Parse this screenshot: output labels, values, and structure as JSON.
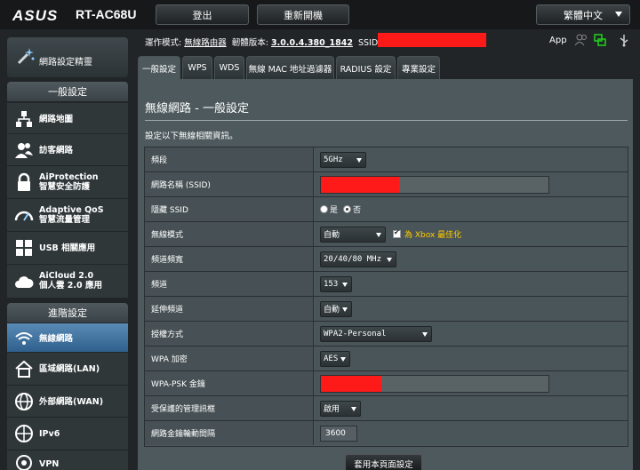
{
  "header": {
    "brand": "ASUS",
    "model": "RT-AC68U",
    "logout_label": "登出",
    "reboot_label": "重新開機",
    "language_label": "繁體中文"
  },
  "status": {
    "mode_label": "運作模式:",
    "mode_value": "無線路由器",
    "firmware_label": "韌體版本:",
    "firmware_value": "3.0.0.4.380_1842",
    "ssid_label": "SSID:",
    "app_label": "App"
  },
  "sidebar": {
    "wizard_label": "網路設定精靈",
    "general_header": "一般設定",
    "general_items": [
      {
        "label": "網路地圖"
      },
      {
        "label": "訪客網路"
      },
      {
        "label": "AiProtection",
        "sub": "智慧安全防護"
      },
      {
        "label": "Adaptive QoS",
        "sub": "智慧流量管理"
      },
      {
        "label": "USB 相關應用"
      },
      {
        "label": "AiCloud 2.0",
        "sub": "個人雲 2.0 應用"
      }
    ],
    "advanced_header": "進階設定",
    "advanced_items": [
      {
        "label": "無線網路"
      },
      {
        "label": "區域網路(LAN)"
      },
      {
        "label": "外部網路(WAN)"
      },
      {
        "label": "IPv6"
      },
      {
        "label": "VPN"
      }
    ]
  },
  "tabs": [
    "一般設定",
    "WPS",
    "WDS",
    "無線 MAC 地址過濾器",
    "RADIUS 設定",
    "專業設定"
  ],
  "page": {
    "title": "無線網路 - 一般設定",
    "description": "設定以下無線相關資訊。",
    "apply_label": "套用本頁面設定"
  },
  "form": {
    "band": {
      "label": "頻段",
      "value": "5GHz"
    },
    "ssid": {
      "label": "網路名稱 (SSID)"
    },
    "hide_ssid": {
      "label": "隱藏 SSID",
      "yes": "是",
      "no": "否",
      "selected": "否"
    },
    "wireless_mode": {
      "label": "無線模式",
      "value": "自動",
      "xbox_label": "為 Xbox 最佳化",
      "xbox_checked": true
    },
    "bandwidth": {
      "label": "頻道頻寬",
      "value": "20/40/80 MHz"
    },
    "channel": {
      "label": "頻道",
      "value": "153"
    },
    "ext_channel": {
      "label": "延伸頻道",
      "value": "自動"
    },
    "auth": {
      "label": "授權方式",
      "value": "WPA2-Personal"
    },
    "wpa_enc": {
      "label": "WPA 加密",
      "value": "AES"
    },
    "psk": {
      "label": "WPA-PSK 金鑰"
    },
    "pmf": {
      "label": "受保護的管理訊框",
      "value": "啟用"
    },
    "key_rotation": {
      "label": "網路金鑰輪動間隔",
      "value": "3600"
    }
  }
}
